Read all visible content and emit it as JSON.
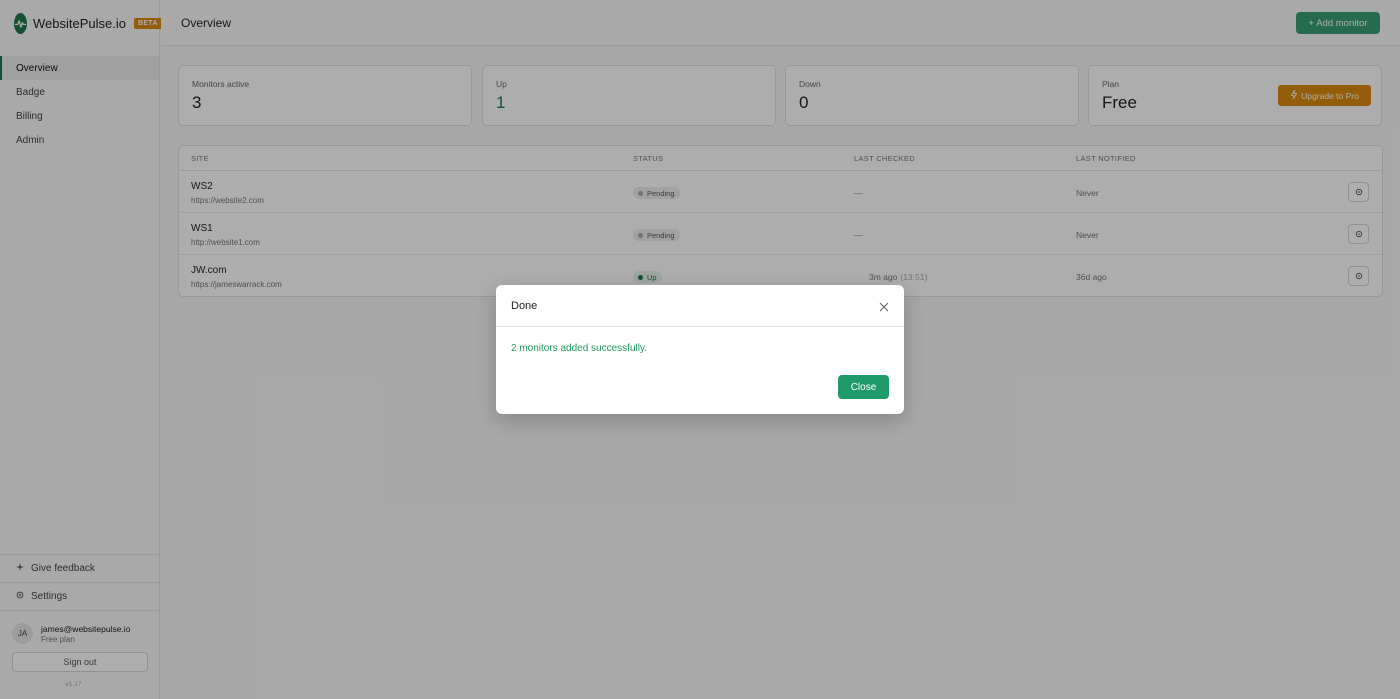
{
  "brand": {
    "name": "WebsitePulse.io",
    "badge": "BETA",
    "logo_icon": "pulse-icon"
  },
  "colors": {
    "accent": "#1f7a4d",
    "upgrade": "#d98a0e",
    "success_text": "#1f9a5e"
  },
  "sidebar": {
    "items": [
      {
        "label": "Overview",
        "active": true
      },
      {
        "label": "Badge"
      },
      {
        "label": "Billing"
      },
      {
        "label": "Admin"
      }
    ],
    "feedback": {
      "label": "Give feedback",
      "icon": "sparkle-icon"
    },
    "settings": {
      "label": "Settings",
      "icon": "gear-icon"
    },
    "user": {
      "initials": "JA",
      "email": "james@websitepulse.io",
      "plan": "Free plan"
    },
    "signout_label": "Sign out",
    "version": "v1.17"
  },
  "header": {
    "title": "Overview",
    "add_label": "+ Add monitor"
  },
  "stats": [
    {
      "label": "Monitors active",
      "value": "3"
    },
    {
      "label": "Up",
      "value": "1"
    },
    {
      "label": "Down",
      "value": "0"
    },
    {
      "label": "Plan",
      "value": "Free",
      "action": "Upgrade to Pro"
    }
  ],
  "table": {
    "columns": [
      "SITE",
      "STATUS",
      "LAST CHECKED",
      "LAST NOTIFIED"
    ],
    "rows": [
      {
        "name": "WS2",
        "url": "https://website2.com",
        "status": "Pending",
        "last_checked": "—",
        "last_checked_time": "",
        "last_notified": "Never"
      },
      {
        "name": "WS1",
        "url": "http://website1.com",
        "status": "Pending",
        "last_checked": "—",
        "last_checked_time": "",
        "last_notified": "Never"
      },
      {
        "name": "JW.com",
        "url": "https://jameswarrack.com",
        "status": "Up",
        "last_checked": "3m ago",
        "last_checked_time": "(13:51)",
        "last_notified": "36d ago"
      }
    ]
  },
  "modal": {
    "title": "Done",
    "message": "2 monitors added successfully.",
    "close_label": "Close"
  }
}
